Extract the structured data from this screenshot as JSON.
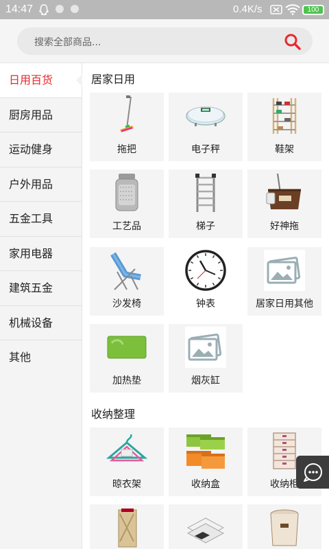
{
  "status": {
    "time": "14:47",
    "speed": "0.4K/s",
    "battery": "100"
  },
  "search": {
    "placeholder": "搜索全部商品..."
  },
  "sidebar": {
    "items": [
      {
        "label": "日用百货"
      },
      {
        "label": "厨房用品"
      },
      {
        "label": "运动健身"
      },
      {
        "label": "户外用品"
      },
      {
        "label": "五金工具"
      },
      {
        "label": "家用电器"
      },
      {
        "label": "建筑五金"
      },
      {
        "label": "机械设备"
      },
      {
        "label": "其他"
      }
    ]
  },
  "sections": [
    {
      "title": "居家日用",
      "items": [
        {
          "label": "拖把",
          "icon": "mop-icon"
        },
        {
          "label": "电子秤",
          "icon": "scale-icon"
        },
        {
          "label": "鞋架",
          "icon": "shoe-rack-icon"
        },
        {
          "label": "工艺品",
          "icon": "craft-jar-icon"
        },
        {
          "label": "梯子",
          "icon": "ladder-icon"
        },
        {
          "label": "好神拖",
          "icon": "spin-mop-icon"
        },
        {
          "label": "沙发椅",
          "icon": "lounge-chair-icon"
        },
        {
          "label": "钟表",
          "icon": "clock-icon"
        },
        {
          "label": "居家日用其他",
          "icon": "image-placeholder-icon"
        },
        {
          "label": "加热垫",
          "icon": "heating-pad-icon"
        },
        {
          "label": "烟灰缸",
          "icon": "image-placeholder-icon"
        }
      ]
    },
    {
      "title": "收纳整理",
      "items": [
        {
          "label": "晾衣架",
          "icon": "hanger-icon"
        },
        {
          "label": "收纳盒",
          "icon": "storage-box-icon"
        },
        {
          "label": "收纳柜",
          "icon": "drawer-cabinet-icon"
        },
        {
          "label": "",
          "icon": "storage-bag-icon"
        },
        {
          "label": "",
          "icon": "organizer-tray-icon"
        },
        {
          "label": "",
          "icon": "trash-bin-icon"
        }
      ]
    }
  ],
  "colors": {
    "accent": "#e8282f",
    "sidebar_bg": "#f4f4f4",
    "tile_bg": "#f4f4f4"
  }
}
